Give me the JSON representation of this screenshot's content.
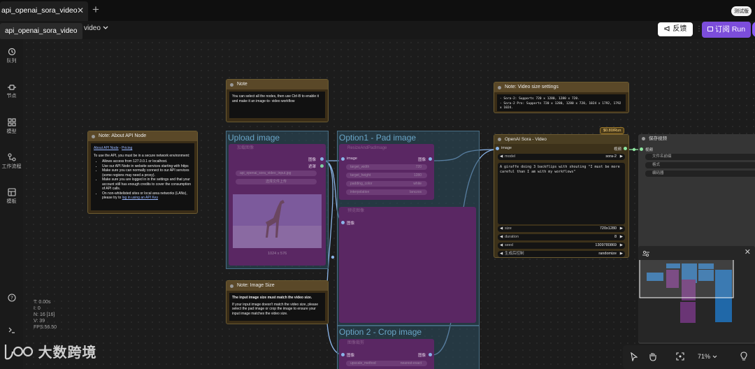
{
  "tab": {
    "title": "api_openai_sora_video",
    "close": "✕",
    "add": "+"
  },
  "badge_test": "测试版",
  "workflow": {
    "tooltip": "api_openai_sora_video",
    "name_suffix": "video"
  },
  "toolbar": {
    "feedback": "反馈",
    "run": "订阅 Run"
  },
  "sidebar": [
    {
      "label": "队列",
      "icon": "history-icon"
    },
    {
      "label": "节点",
      "icon": "node-icon"
    },
    {
      "label": "模型",
      "icon": "model-icon"
    },
    {
      "label": "工作流程",
      "icon": "workflow-icon"
    },
    {
      "label": "模板",
      "icon": "template-icon"
    }
  ],
  "notes": {
    "api": {
      "title": "Note: About API Node",
      "link1": "About API Node",
      "sep": " - ",
      "link2": "Pricing",
      "intro": "To use the API, you must be in a secure network environment:",
      "b1": "Allows access from 127.0.0.1 or localhost.",
      "b2": "Use our API Node in website services starting with https",
      "b3": "Make sure you can normally connect to our API services (some regions may need a proxy).",
      "b4": "Make sure you are logged in in the settings and that your account still has enough credits to cover the consumption of API calls.",
      "b5": "On non-whitelisted sites or local area networks (LANs), please try to",
      "b5link": "log in using an API Key"
    },
    "note": {
      "title": "Note",
      "text": "You can select all the nodes, then use Ctrl-B to enable it and make it an image-to- video workflow"
    },
    "imgsize": {
      "title": "Note: Image Size",
      "bold": "The input image size must match the video size.",
      "text": "If your input image doesn't match the video size, please select the pad image or crop the image to ensure your input image matches the video size."
    },
    "videosize": {
      "title": "Note: Video size settings",
      "l1": "- Sora-2: Supports 720 x 1280, 1280 x 720.",
      "l2": "- Sora-2 Pro: Supports 720 x 1280, 1280 x 720, 1024 x 1792, 1792 x 1024."
    }
  },
  "groups": {
    "upload": "Upload image",
    "pad": "Option1 - Pad image",
    "crop": "Option 2 - Crop image"
  },
  "upload_node": {
    "title": "加载图像",
    "out_image": "图像",
    "out_mask": "遮罩",
    "file": "api_openai_sora_video_input.jpg",
    "upload_btn": "选择文件上传",
    "dims": "1024 x 576"
  },
  "pad_node": {
    "title": "ResizeAndPadImage",
    "in": "image",
    "out": "图像",
    "w1_label": "target_width",
    "w1_val": "720",
    "w2_label": "target_height",
    "w2_val": "1280",
    "w3_label": "padding_color",
    "w3_val": "white",
    "w4_label": "interpolation",
    "w4_val": "lanczos"
  },
  "preview_node": {
    "title": "预览图像",
    "in": "图像"
  },
  "crop_node": {
    "title": "图像裁剪",
    "in": "图像",
    "out": "图像",
    "w1_label": "upscale_method",
    "w1_val": "nearest-exact"
  },
  "sora": {
    "title": "OpenAI Sora - Video",
    "in": "image",
    "out": "视频",
    "model_label": "model",
    "model_val": "sora-2",
    "prompt": "A giraffe doing 3 backflips with shouting \"I must be more  careful than I am with my workflows\"",
    "size_label": "size",
    "size_val": "720x1280",
    "duration_label": "duration",
    "duration_val": "8",
    "seed_label": "seed",
    "seed_val": "1309780869",
    "ctrl_label": "生成后控制",
    "ctrl_val": "randomize"
  },
  "price": "$0.80/Run",
  "save_node": {
    "title": "保存视频",
    "in": "视频",
    "w1": "文件名前缀",
    "w2": "格式",
    "w3": "编码器"
  },
  "bottom": {
    "zoom": "71%"
  },
  "stats": {
    "t": "T: 0.00s",
    "i": "I: 0",
    "n": "N: 16 [16]",
    "v": "V: 39",
    "fps": "FPS:56.50"
  },
  "watermark": "大数跨境",
  "colors": {
    "accent": "#7c4ddb",
    "link": "#8ab4e8",
    "note_header": "#5a4828",
    "group_title": "#6aa6c8",
    "node_purple": "#5a2763"
  }
}
